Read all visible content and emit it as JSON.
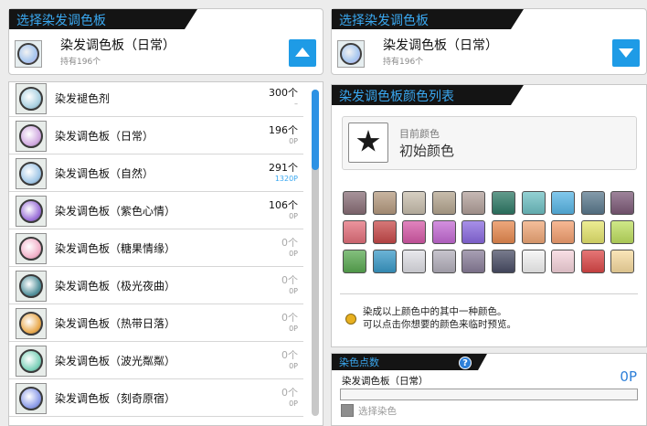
{
  "left_panel": {
    "header": "选择染发调色板",
    "selected": {
      "title": "染发调色板（日常）",
      "sub": "持有196个"
    }
  },
  "right_panel": {
    "header": "选择染发调色板",
    "selected": {
      "title": "染发调色板（日常）",
      "sub": "持有196个"
    }
  },
  "item_list": [
    {
      "name": "染发褪色剂",
      "count": "300个",
      "points": "–",
      "points_blue": false,
      "zero": false,
      "color": "#a8cfe0"
    },
    {
      "name": "染发调色板（日常）",
      "count": "196个",
      "points": "0P",
      "points_blue": false,
      "zero": false,
      "color": "#d0a8e0"
    },
    {
      "name": "染发调色板（自然）",
      "count": "291个",
      "points": "1320P",
      "points_blue": true,
      "zero": false,
      "color": "#9fc6e6"
    },
    {
      "name": "染发调色板（紫色心情）",
      "count": "106个",
      "points": "0P",
      "points_blue": false,
      "zero": false,
      "color": "#9a6fd8"
    },
    {
      "name": "染发调色板（糖果情缘）",
      "count": "0个",
      "points": "0P",
      "points_blue": false,
      "zero": true,
      "color": "#f2b0c8"
    },
    {
      "name": "染发调色板（极光夜曲）",
      "count": "0个",
      "points": "0P",
      "points_blue": false,
      "zero": true,
      "color": "#4f8f9a"
    },
    {
      "name": "染发调色板（热带日落）",
      "count": "0个",
      "points": "0P",
      "points_blue": false,
      "zero": true,
      "color": "#e8a84a"
    },
    {
      "name": "染发调色板（波光粼粼）",
      "count": "0个",
      "points": "0P",
      "points_blue": false,
      "zero": true,
      "color": "#7ad0b8"
    },
    {
      "name": "染发调色板（刻奇原宿）",
      "count": "0个",
      "points": "0P",
      "points_blue": false,
      "zero": true,
      "color": "#8a9ae8"
    }
  ],
  "color_list": {
    "header": "染发调色板颜色列表",
    "current_label": "目前颜色",
    "current_value": "初始颜色",
    "colors": [
      "#8a6f78",
      "#b69b80",
      "#c9bfae",
      "#b5a690",
      "#b3a19b",
      "#2e7a66",
      "#6fc1c4",
      "#58b6e6",
      "#5b7a8e",
      "#7d5a78",
      "#e4707c",
      "#c84a4a",
      "#d65aa8",
      "#c46ad4",
      "#8a6ae0",
      "#e88a50",
      "#f0a878",
      "#f4a070",
      "#e6e66e",
      "#bfe060",
      "#5aaa52",
      "#3a9ac8",
      "#e0e0e6",
      "#b4b0bc",
      "#8a7e9a",
      "#4a4e66",
      "#f4f4f4",
      "#f6d4dc",
      "#dc4848",
      "#f8dca0"
    ],
    "note_line1": "染成以上颜色中的其中一种颜色。",
    "note_line2": "可以点击你想要的颜色来临时预览。"
  },
  "dye_points": {
    "header": "染色点数",
    "help": "?",
    "item": "染发调色板（日常）",
    "value": "0P",
    "progress": 0,
    "checkbox_label": "选择染色"
  }
}
